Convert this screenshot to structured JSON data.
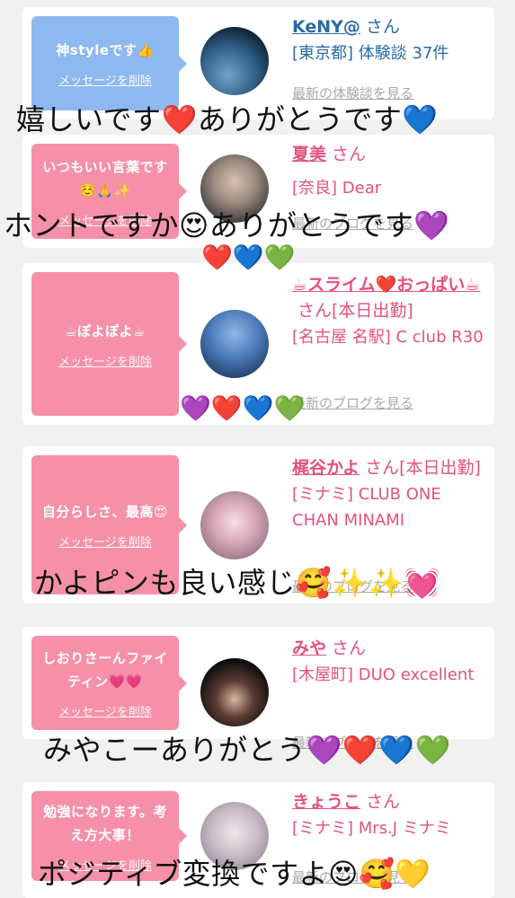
{
  "cards": [
    {
      "message": "神styleです👍",
      "delete_label": "メッセージを削除",
      "name": "KeNY@",
      "honorific": "さん",
      "location": "[東京都] 体験談 37件",
      "link": "最新の体験談を見る",
      "bubble_color": "#8db8f0"
    },
    {
      "message": "いつもいい言葉です☺️🙏✨",
      "delete_label": "メッセージを削除",
      "name": "夏美",
      "honorific": "さん",
      "location": "[奈良] Dear",
      "link": "最新のブログを見る",
      "bubble_color": "#f590a8"
    },
    {
      "message": "☕ぽよぽよ☕",
      "delete_label": "メッセージを削除",
      "name": "☕スライム❤️おっぱい☕",
      "honorific": "さん[本日出勤]",
      "location": "[名古屋 名駅] C club R30",
      "link": "最新のブログを見る",
      "bubble_color": "#f590a8"
    },
    {
      "message": "自分らしさ、最高😍",
      "delete_label": "メッセージを削除",
      "name": "梶谷かよ",
      "honorific": "さん[本日出勤]",
      "location": "[ミナミ] CLUB ONE CHAN MINAMI",
      "link": "最新のブログを見る",
      "bubble_color": "#f590a8"
    },
    {
      "message": "しおりさーんファイティン💗💗",
      "delete_label": "メッセージを削除",
      "name": "みや",
      "honorific": "さん",
      "location": "[木屋町] DUO excellent",
      "link": "最新のブログを見る",
      "bubble_color": "#f590a8"
    },
    {
      "message": "勉強になります。考え方大事！",
      "delete_label": "メッセージを削除",
      "name": "きょうこ",
      "honorific": "さん",
      "location": "[ミナミ] Mrs.J ミナミ",
      "link": "最新のブログを見る",
      "bubble_color": "#f590a8"
    }
  ],
  "overlays": {
    "o1": "嬉しいです❤️ありがとうです💙",
    "o2": "ホントですか😍ありがとうです💜",
    "o2b": "❤️💙💚",
    "o3": "💜❤️💙💚",
    "o4": "かよピンも良い感じ🥰✨✨💓",
    "o5": "みやこーありがとう💜❤️💙💚",
    "o6": "ポジティブ変換ですよ😍🥰💛"
  },
  "colors": {
    "pink_text": "#e4527b",
    "blue_text": "#2a6aa8",
    "bubble_pink": "#f590a8",
    "bubble_blue": "#8db8f0"
  }
}
